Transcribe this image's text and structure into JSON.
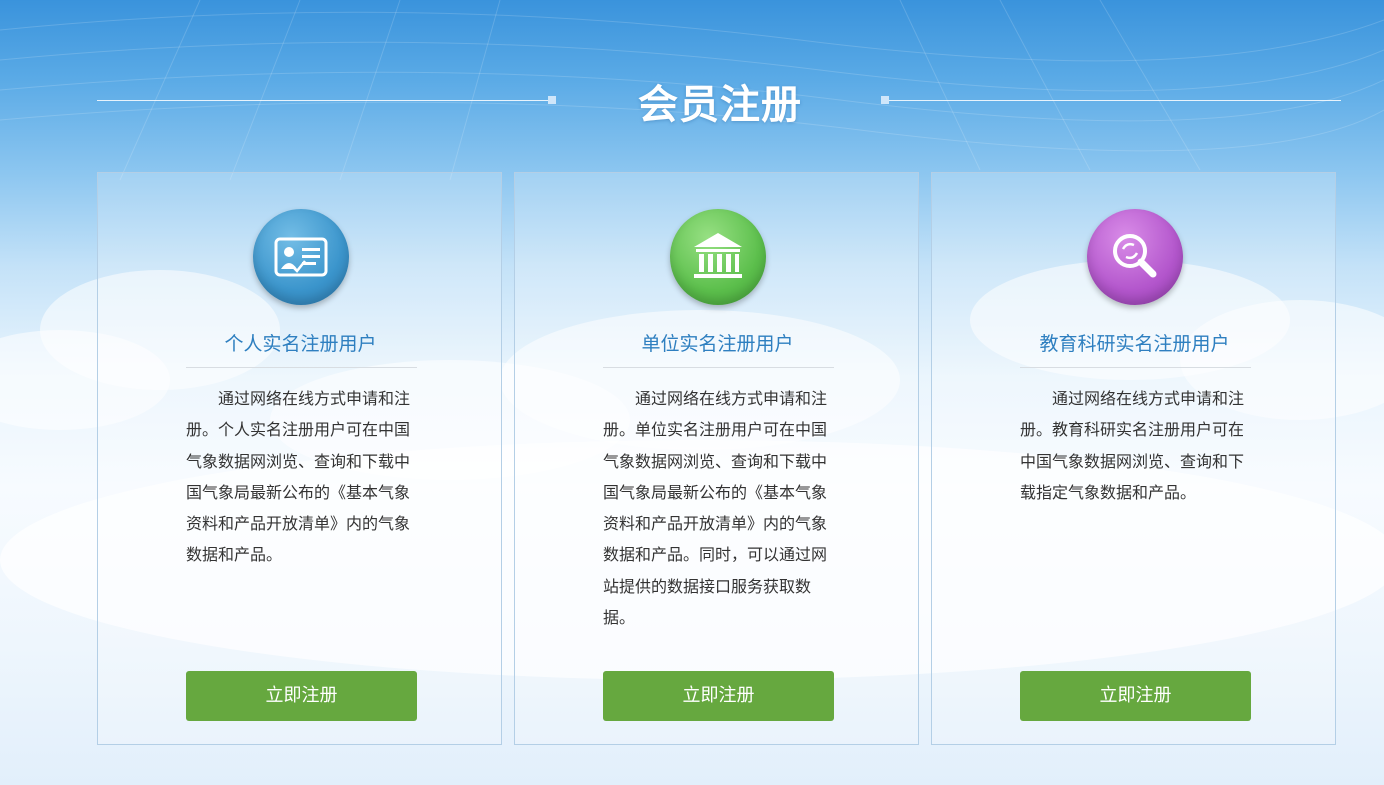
{
  "page": {
    "title": "会员注册"
  },
  "colors": {
    "accent_blue": "#2e7fc0",
    "button_green": "#66a83f",
    "icon_blue": "#3b95cc",
    "icon_green": "#5cbf4c",
    "icon_purple": "#b356cc"
  },
  "cards": [
    {
      "icon": "id-card-icon",
      "title": "个人实名注册用户",
      "description": "通过网络在线方式申请和注册。个人实名注册用户可在中国气象数据网浏览、查询和下载中国气象局最新公布的《基本气象资料和产品开放清单》内的气象数据和产品。",
      "button_label": "立即注册"
    },
    {
      "icon": "institution-building-icon",
      "title": "单位实名注册用户",
      "description": "通过网络在线方式申请和注册。单位实名注册用户可在中国气象数据网浏览、查询和下载中国气象局最新公布的《基本气象资料和产品开放清单》内的气象数据和产品。同时，可以通过网站提供的数据接口服务获取数据。",
      "button_label": "立即注册"
    },
    {
      "icon": "research-magnifier-icon",
      "title": "教育科研实名注册用户",
      "description": "通过网络在线方式申请和注册。教育科研实名注册用户可在中国气象数据网浏览、查询和下载指定气象数据和产品。",
      "button_label": "立即注册"
    }
  ]
}
